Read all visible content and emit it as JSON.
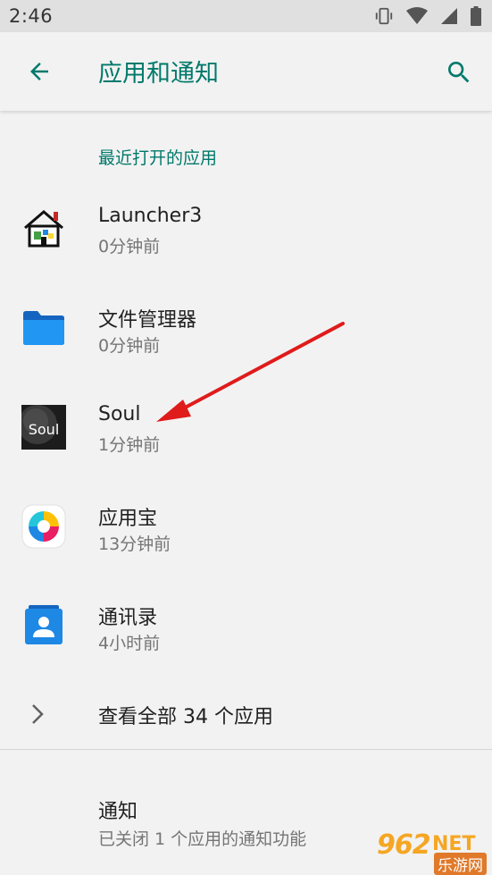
{
  "status_bar": {
    "time": "2:46",
    "icons": [
      "vibrate-icon",
      "wifi-icon",
      "cellular-icon",
      "battery-icon"
    ]
  },
  "app_bar": {
    "back_icon": "arrow-back-icon",
    "title": "应用和通知",
    "search_icon": "search-icon"
  },
  "recent": {
    "header": "最近打开的应用",
    "apps": [
      {
        "name": "Launcher3",
        "time": "0分钟前",
        "icon": "launcher-house-icon"
      },
      {
        "name": "文件管理器",
        "time": "0分钟前",
        "icon": "folder-icon"
      },
      {
        "name": "Soul",
        "time": "1分钟前",
        "icon": "soul-app-icon",
        "icon_text": "Soul"
      },
      {
        "name": "应用宝",
        "time": "13分钟前",
        "icon": "yingyongbao-icon"
      },
      {
        "name": "通讯录",
        "time": "4小时前",
        "icon": "contacts-icon"
      }
    ]
  },
  "see_all": {
    "label": "查看全部 34 个应用",
    "icon": "chevron-right-icon"
  },
  "notifications": {
    "title": "通知",
    "subtitle": "已关闭 1 个应用的通知功能"
  },
  "annotation": {
    "color": "#e01b1b"
  },
  "watermark": {
    "number": "962",
    "suffix": "NET",
    "subtitle": "乐游网"
  },
  "colors": {
    "accent": "#00796b",
    "background": "#f2f2f2",
    "status_bar": "#e0e0e0"
  }
}
